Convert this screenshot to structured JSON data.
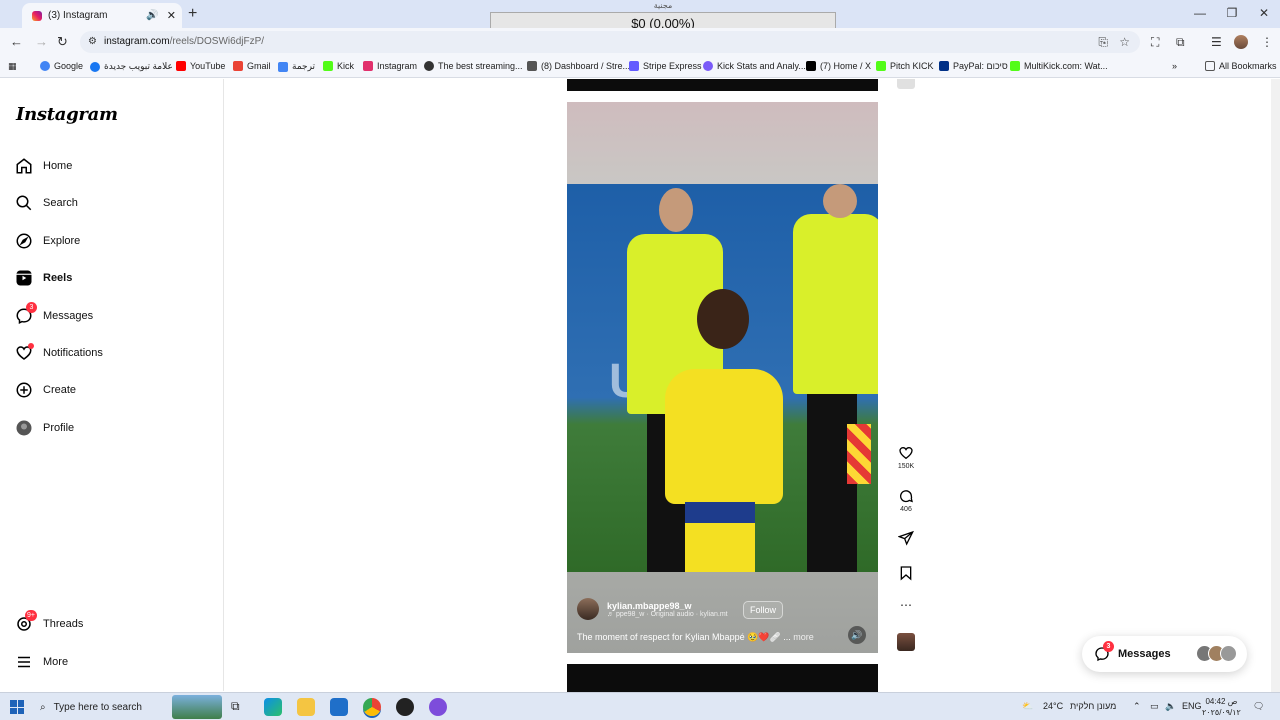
{
  "browser": {
    "tab": {
      "title": "(3) Instagram"
    },
    "popup": {
      "header": "مجنية",
      "value": "$0 (0.00%)"
    },
    "url": {
      "host": "instagram.com",
      "path": "/reels/DOSWi6djFzP/"
    },
    "bookmarks": [
      {
        "label": "Google",
        "color": "#4285f4"
      },
      {
        "label": "علامة تبويب جديدة",
        "color": "#1877f2"
      },
      {
        "label": "YouTube",
        "color": "#ff0000"
      },
      {
        "label": "Gmail",
        "color": "#ea4335"
      },
      {
        "label": "ترجمة",
        "color": "#4285f4"
      },
      {
        "label": "Kick",
        "color": "#53fc18"
      },
      {
        "label": "Instagram",
        "color": "#e1306c"
      },
      {
        "label": "The best streaming...",
        "color": "#333333"
      },
      {
        "label": "(8) Dashboard / Stre...",
        "color": "#555555"
      },
      {
        "label": "Stripe Express",
        "color": "#635bff"
      },
      {
        "label": "Kick Stats and Analy...",
        "color": "#7a5af8"
      },
      {
        "label": "(7) Home / X",
        "color": "#000000"
      },
      {
        "label": "Pitch KICK",
        "color": "#53fc18"
      },
      {
        "label": "PayPal: סיכום",
        "color": "#003087"
      },
      {
        "label": "MultiKick.com: Wat...",
        "color": "#53fc18"
      }
    ],
    "all_bookmarks": "All Bookmarks"
  },
  "sidebar": {
    "logo": "Instagram",
    "items": [
      {
        "label": "Home",
        "icon": "home-icon"
      },
      {
        "label": "Search",
        "icon": "search-icon"
      },
      {
        "label": "Explore",
        "icon": "compass-icon"
      },
      {
        "label": "Reels",
        "icon": "reels-icon"
      },
      {
        "label": "Messages",
        "icon": "messenger-icon",
        "badge": "3"
      },
      {
        "label": "Notifications",
        "icon": "heart-icon"
      },
      {
        "label": "Create",
        "icon": "plus-square-icon"
      },
      {
        "label": "Profile",
        "icon": "avatar"
      },
      {
        "label": "Threads",
        "icon": "threads-icon",
        "badge": "9+"
      },
      {
        "label": "More",
        "icon": "menu-icon"
      }
    ]
  },
  "reel": {
    "board_text": "Ub",
    "author": "kylian.mbappe98_w",
    "audio": "♬ ppe98_w · Original audio · kylian.mt",
    "follow": "Follow",
    "caption": "The moment of respect for Kylian Mbappé 🥹❤️🩹 ...",
    "more": "more"
  },
  "actions": {
    "likes": "150K",
    "comments": "406"
  },
  "messages_pill": {
    "label": "Messages",
    "badge": "3"
  },
  "taskbar": {
    "search_placeholder": "Type here to search",
    "weather": "24°C",
    "weather_text": "מעונן חלקית",
    "lang": "ENG",
    "time": "04:42 ص",
    "date": "٢٠٢٥/٠٩/١٢"
  }
}
